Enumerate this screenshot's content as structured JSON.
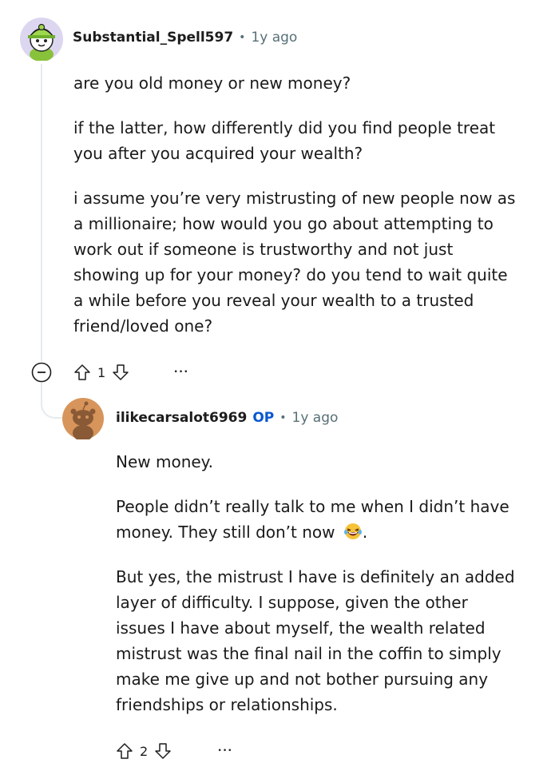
{
  "comment": {
    "username": "Substantial_Spell597",
    "time": "1y ago",
    "paragraphs": [
      [
        "are you old money or new money?"
      ],
      [
        "if the latter, how differently did you find people treat",
        "you after you acquired your wealth?"
      ],
      [
        "i assume you’re very mistrusting of new people now as",
        "a millionaire; how would you go about attempting to",
        "work out if someone is trustworthy and not just",
        "showing up for your money? do you tend to wait quite",
        "a while before you reveal your wealth to a trusted",
        "friend/loved one?"
      ]
    ],
    "votes": "1",
    "more": "•••"
  },
  "reply": {
    "username": "ilikecarsalot6969",
    "op_badge": "OP",
    "time": "1y ago",
    "para1": "New money.",
    "para2_line1": "People didn’t really talk to me when I didn’t have",
    "para2_line2": "money. They still don’t now",
    "para2_end": ".",
    "para3": [
      "But yes, the mistrust I have is definitely an added",
      "layer of difficulty. I suppose, given the other",
      "issues I have about myself, the wealth related",
      "mistrust was the final nail in the coffin to simply",
      "make me give up and not bother pursuing any",
      "friendships or relationships."
    ],
    "votes": "2",
    "more": "•••"
  },
  "colors": {
    "thread": "#e5ebee",
    "op": "#0a57d0",
    "meta": "#576f76",
    "avatar1_bg": "#ddd6f0",
    "avatar2_bg": "#d7955b"
  },
  "icons": [
    "collapse-icon",
    "upvote-icon",
    "downvote-icon",
    "more-icon",
    "laughing-emoji-icon"
  ]
}
